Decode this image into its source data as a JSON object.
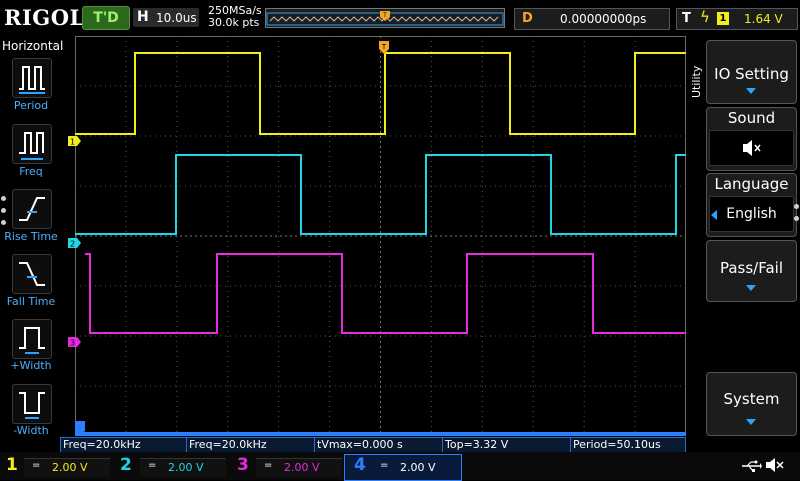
{
  "brand": "RIGOL",
  "run_status": "T'D",
  "horizontal": {
    "letter": "H",
    "timebase": "10.0us"
  },
  "sample_rate": "250MSa/s",
  "memory_depth": "30.0k pts",
  "delay": {
    "letter": "D",
    "value": "0.00000000ps"
  },
  "trigger": {
    "letter": "T",
    "source": "1",
    "level": "1.64 V"
  },
  "left_panel": {
    "title": "Horizontal",
    "items": [
      {
        "label": "Period",
        "icon": "period-icon"
      },
      {
        "label": "Freq",
        "icon": "freq-icon"
      },
      {
        "label": "Rise Time",
        "icon": "rise-time-icon"
      },
      {
        "label": "Fall Time",
        "icon": "fall-time-icon"
      },
      {
        "label": "+Width",
        "icon": "positive-width-icon"
      },
      {
        "label": "-Width",
        "icon": "negative-width-icon"
      }
    ]
  },
  "right_menu": {
    "tab": "Utility",
    "items": [
      {
        "label": "IO Setting"
      },
      {
        "label": "Sound",
        "value_icon": "speaker-muted-icon"
      },
      {
        "label": "Language",
        "value": "English"
      },
      {
        "label": "Pass/Fail"
      },
      {
        "label": "System"
      }
    ]
  },
  "channel_markers": [
    "1",
    "2",
    "3"
  ],
  "measurements": [
    {
      "text": "Freq=20.0kHz"
    },
    {
      "text": "Freq=20.0kHz"
    },
    {
      "text": "tVmax=0.000 s"
    },
    {
      "text": "Top=3.32 V"
    },
    {
      "text": "Period=50.10us"
    }
  ],
  "channels": [
    {
      "num": "1",
      "coupling": "=",
      "scale": "2.00 V",
      "color": "#f2ee1a"
    },
    {
      "num": "2",
      "coupling": "=",
      "scale": "2.00 V",
      "color": "#1fd6e6"
    },
    {
      "num": "3",
      "coupling": "=",
      "scale": "2.00 V",
      "color": "#e62ae0"
    },
    {
      "num": "4",
      "coupling": "=",
      "scale": "2.00 V",
      "color": "#2a7fff"
    }
  ],
  "status_icons": [
    "usb-icon",
    "speaker-muted-icon"
  ],
  "colors": {
    "ch1": "#f2ee1a",
    "ch2": "#1fd6e6",
    "ch3": "#e62ae0",
    "ch4": "#2a7fff",
    "accent": "#2aa4ff",
    "trigger": "#f5a623"
  }
}
